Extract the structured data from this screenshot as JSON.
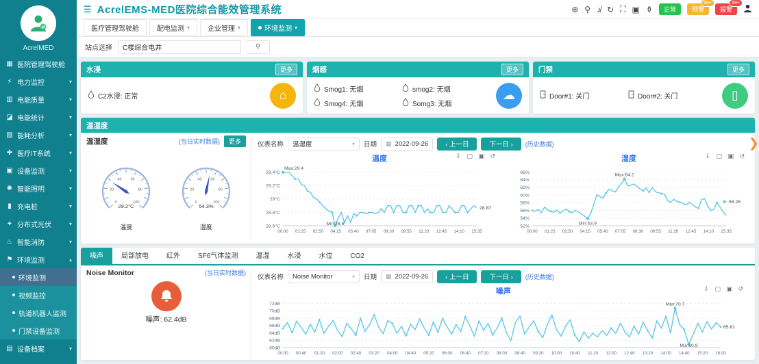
{
  "app": {
    "title": "AcrelEMS-MED医院综合能效管理系统",
    "logo_text": "AcrelMED",
    "badges": {
      "green": "正常",
      "yellow": "预警",
      "yellow_count": "99+",
      "red": "报警",
      "red_count": "99+"
    }
  },
  "sidebar": {
    "items": [
      {
        "label": "医院管理驾驶舱",
        "icon": "cockpit-icon",
        "chevron": false
      },
      {
        "label": "电力监控",
        "icon": "power-icon",
        "chevron": true
      },
      {
        "label": "电能质量",
        "icon": "quality-icon",
        "chevron": true
      },
      {
        "label": "电能统计",
        "icon": "stats-icon",
        "chevron": true
      },
      {
        "label": "能耗分析",
        "icon": "analysis-icon",
        "chevron": true
      },
      {
        "label": "医疗IT系统",
        "icon": "medical-it-icon",
        "chevron": true
      },
      {
        "label": "设备监测",
        "icon": "device-icon",
        "chevron": true
      },
      {
        "label": "智能照明",
        "icon": "lighting-icon",
        "chevron": true
      },
      {
        "label": "充电桩",
        "icon": "charging-icon",
        "chevron": true
      },
      {
        "label": "分布式光伏",
        "icon": "pv-icon",
        "chevron": true
      },
      {
        "label": "智能消防",
        "icon": "fire-icon",
        "chevron": true
      },
      {
        "label": "环境监测",
        "icon": "environment-icon",
        "expanded": true,
        "children": [
          {
            "label": "环境监测",
            "active": true
          },
          {
            "label": "视频监控",
            "active": false
          },
          {
            "label": "轨道机器人监测",
            "active": false
          },
          {
            "label": "门禁设备监测",
            "active": false
          }
        ]
      },
      {
        "label": "设备档案",
        "icon": "archive-icon",
        "chevron": true
      }
    ]
  },
  "navtabs": [
    {
      "label": "医疗管理驾驶舱",
      "caret": false,
      "active": false
    },
    {
      "label": "配电监测",
      "caret": true,
      "active": false
    },
    {
      "label": "企业管理",
      "caret": true,
      "active": false
    },
    {
      "label": "环境监测",
      "caret": true,
      "active": true
    }
  ],
  "search": {
    "label": "站点选择",
    "value": "C楼综合电井"
  },
  "cards": {
    "water": {
      "title": "水浸",
      "more": "更多",
      "items": [
        {
          "name": "C2水浸",
          "status": "正常"
        }
      ]
    },
    "smoke": {
      "title": "烟感",
      "more": "更多",
      "items": [
        {
          "name": "Smog1",
          "status": "无烟"
        },
        {
          "name": "smog2",
          "status": "无烟"
        },
        {
          "name": "Smog4",
          "status": "无烟"
        },
        {
          "name": "Somg3",
          "status": "无烟"
        }
      ]
    },
    "door": {
      "title": "门禁",
      "more": "更多",
      "items": [
        {
          "name": "Door#1",
          "status": "关门"
        },
        {
          "name": "Door#2",
          "status": "关门"
        }
      ]
    }
  },
  "env": {
    "title": "温湿度",
    "left": {
      "subtitle": "温湿度",
      "realtime_link": "(当日实时数据)",
      "more": "更多"
    },
    "controls": {
      "meter_label": "仪表名称",
      "meter_value": "温湿度",
      "date_label": "日期",
      "date_value": "2022-09-26",
      "prev": "‹ 上一日",
      "next": "下一日 ›",
      "history_link": "(历史数据)"
    }
  },
  "noise": {
    "tabs": [
      "噪声",
      "局部放电",
      "红外",
      "SF6气体监测",
      "温湿",
      "水浸",
      "水位",
      "CO2"
    ],
    "active_tab": 0,
    "left": {
      "subtitle": "Noise Monitor",
      "realtime_link": "(当日实时数据)",
      "reading_label": "噪声",
      "reading_value": "62.4dB"
    },
    "controls": {
      "meter_label": "仪表名称",
      "meter_value": "Noise Monitor",
      "date_label": "日期",
      "date_value": "2022-09-26",
      "prev": "‹ 上一日",
      "next": "下一日 ›",
      "history_link": "(历史数据)"
    }
  },
  "chart_data": [
    {
      "type": "gauge",
      "title": "温度",
      "value": 29.2,
      "display": "29.2°C",
      "min": 0,
      "max": 100,
      "ticks": [
        0,
        20,
        40,
        60,
        80,
        100
      ]
    },
    {
      "type": "gauge",
      "title": "湿度",
      "value": 54.3,
      "display": "54.3%",
      "min": 0,
      "max": 100,
      "ticks": [
        0,
        20,
        40,
        60,
        80,
        100
      ]
    },
    {
      "type": "line",
      "title": "温度",
      "color": "#55c5e6",
      "ylim": [
        28.6,
        29.45
      ],
      "yticks": [
        {
          "v": 29.4,
          "label": "29.4°C"
        },
        {
          "v": 29.2,
          "label": "29.2°C"
        },
        {
          "v": 29.0,
          "label": "29°C"
        },
        {
          "v": 28.8,
          "label": "28.8°C"
        },
        {
          "v": 28.6,
          "label": "28.6°C"
        }
      ],
      "xlabels": [
        "00:00",
        "01:25",
        "02:50",
        "04:15",
        "05:40",
        "07:05",
        "08:30",
        "09:55",
        "11:20",
        "12:45",
        "14:10",
        "15:35"
      ],
      "values": [
        29.4,
        29.4,
        29.4,
        29.35,
        29.3,
        29.3,
        29.22,
        29.2,
        29.12,
        29.1,
        29.02,
        29.0,
        28.95,
        28.9,
        28.85,
        28.82,
        28.8,
        28.6,
        28.72,
        28.8,
        28.65,
        28.75,
        28.65,
        28.78,
        28.75,
        28.8,
        28.8,
        28.78,
        28.8,
        28.8,
        28.78,
        28.8,
        28.85,
        28.8,
        28.9,
        28.9,
        28.8,
        28.9,
        28.9,
        28.8,
        28.8,
        28.9,
        28.9,
        28.8,
        28.9,
        28.9,
        28.8,
        28.85,
        28.8,
        28.8,
        28.9,
        28.9,
        28.8,
        28.8,
        28.9,
        28.85,
        28.8,
        28.8,
        28.9,
        28.9,
        28.8,
        28.85,
        28.9,
        28.87
      ],
      "max_idx": 0,
      "max_text": "Max:29.4",
      "min_idx": 17,
      "min_text": "Min:28.6",
      "end_label": "28.87",
      "end_v": 28.87,
      "arrow": false,
      "markers_every": 4
    },
    {
      "type": "line",
      "title": "湿度",
      "color": "#55c5e6",
      "ylim": [
        52,
        66.8
      ],
      "yticks": [
        {
          "v": 66,
          "label": "66%"
        },
        {
          "v": 64,
          "label": "64%"
        },
        {
          "v": 62,
          "label": "62%"
        },
        {
          "v": 60,
          "label": "60%"
        },
        {
          "v": 58,
          "label": "58%"
        },
        {
          "v": 56,
          "label": "56%"
        },
        {
          "v": 54,
          "label": "54%"
        },
        {
          "v": 52,
          "label": "52%"
        }
      ],
      "xlabels": [
        "00:00",
        "01:25",
        "02:50",
        "04:15",
        "05:40",
        "07:05",
        "08:30",
        "09:55",
        "11:20",
        "12:45",
        "14:10",
        "15:35"
      ],
      "values": [
        56.0,
        55.8,
        56.3,
        55.4,
        56.9,
        56.1,
        55.8,
        55.5,
        56.1,
        55.2,
        55.9,
        56.4,
        55.7,
        55.4,
        56.0,
        55.6,
        55.1,
        54.5,
        53.9,
        55.2,
        57.6,
        60.1,
        59.6,
        59.2,
        60.6,
        61.6,
        61.1,
        60.8,
        62.1,
        63.1,
        64.2,
        62.4,
        62.6,
        62.9,
        62.3,
        61.6,
        61.1,
        61.9,
        60.6,
        62.0,
        60.9,
        60.6,
        60.4,
        60.2,
        58.6,
        58.1,
        58.9,
        58.4,
        58.1,
        57.9,
        57.4,
        58.1,
        57.6,
        56.9,
        56.6,
        58.8,
        59.1,
        57.1,
        56.0,
        56.3,
        58.1,
        56.9,
        55.6,
        54.7
      ],
      "max_idx": 30,
      "max_text": "Max:64.2",
      "min_idx": 18,
      "min_text": "Min:53.9",
      "end_label": "58.28",
      "end_v": 58.28,
      "arrow": true,
      "markers_every": 6
    },
    {
      "type": "line",
      "title": "噪声",
      "color": "#55c5e6",
      "ylim": [
        60,
        72.5
      ],
      "yticks": [
        {
          "v": 72,
          "label": "72dB"
        },
        {
          "v": 70,
          "label": "70dB"
        },
        {
          "v": 68,
          "label": "68dB"
        },
        {
          "v": 66,
          "label": "66dB"
        },
        {
          "v": 64,
          "label": "64dB"
        },
        {
          "v": 62,
          "label": "62dB"
        },
        {
          "v": 60,
          "label": "60dB"
        }
      ],
      "xlabels": [
        "00:00",
        "00:40",
        "01:20",
        "02:00",
        "02:40",
        "03:20",
        "04:00",
        "04:40",
        "05:20",
        "06:00",
        "06:40",
        "07:20",
        "08:00",
        "08:40",
        "09:20",
        "10:00",
        "10:40",
        "11:20",
        "12:00",
        "12:40",
        "13:20",
        "14:00",
        "14:40",
        "15:20",
        "16:00"
      ],
      "values": [
        65.2,
        66.8,
        64.0,
        67.2,
        65.5,
        63.6,
        66.4,
        64.2,
        67.6,
        63.9,
        65.8,
        67.4,
        64.6,
        63.0,
        66.6,
        65.1,
        63.4,
        68.0,
        64.4,
        66.2,
        69.0,
        65.6,
        63.8,
        67.4,
        66.6,
        63.9,
        65.8,
        63.1,
        66.4,
        64.9,
        67.8,
        65.3,
        63.4,
        67.0,
        64.1,
        68.0,
        65.6,
        63.7,
        66.3,
        64.4,
        68.4,
        65.9,
        63.1,
        67.3,
        64.7,
        66.6,
        63.4,
        65.3,
        68.0,
        64.1,
        61.9,
        66.9,
        68.6,
        63.7,
        65.6,
        67.3,
        64.4,
        62.7,
        66.3,
        68.9,
        64.9,
        63.1,
        65.9,
        67.6,
        63.4,
        61.6,
        64.3,
        62.6,
        63.9,
        62.9,
        64.6,
        63.3,
        65.3,
        63.9,
        66.6,
        64.3,
        62.9,
        65.9,
        63.6,
        66.9,
        64.6,
        62.6,
        67.3,
        65.3,
        68.6,
        63.9,
        70.7,
        66.3,
        64.9,
        60.9,
        63.6,
        66.6,
        64.3,
        67.1,
        65.0,
        66.8,
        65.61
      ],
      "max_idx": 86,
      "max_text": "Max:70.7",
      "min_idx": 89,
      "min_text": "Min:60.9",
      "end_label": "65.61",
      "end_v": 65.61,
      "arrow": false,
      "markers_every": 8
    }
  ]
}
